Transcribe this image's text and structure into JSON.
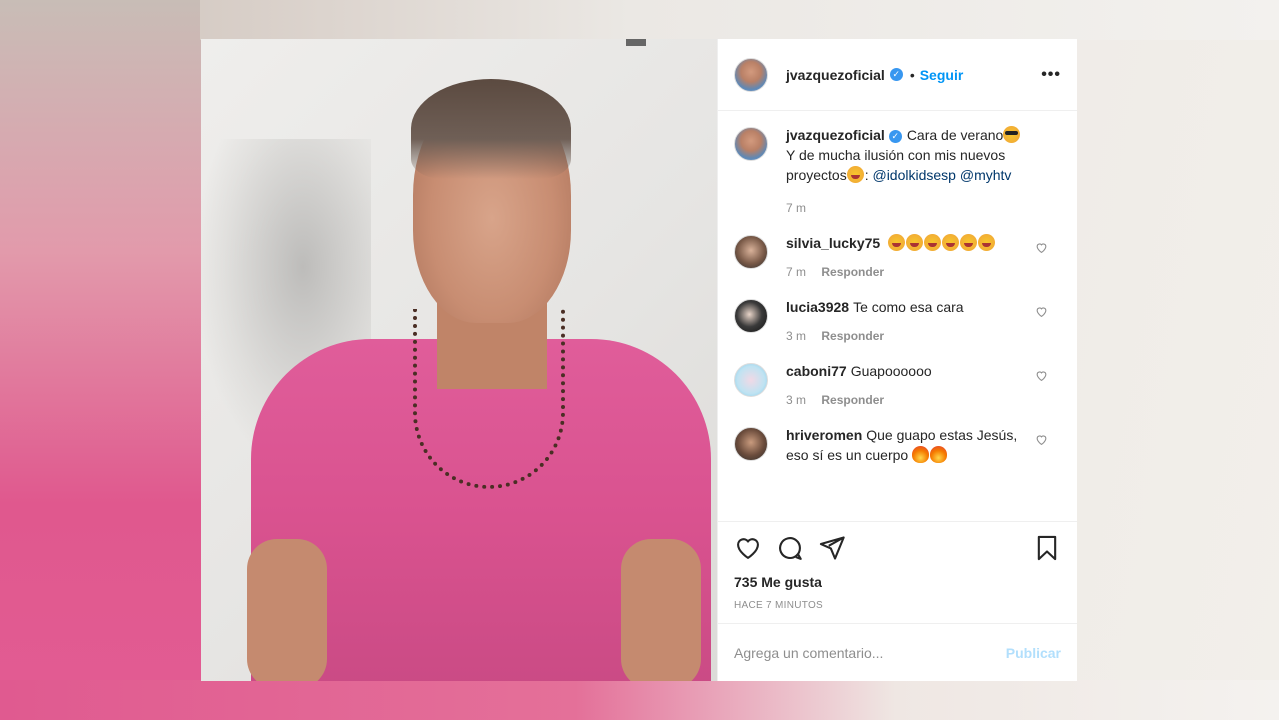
{
  "post": {
    "author": "jvazquezoficial",
    "follow_label": "Seguir",
    "dot": "•",
    "more": "•••",
    "caption": {
      "line1": "Cara de verano",
      "line2": "Y de mucha ilusión con mis nuevos",
      "line3": "proyectos",
      "mentions_sep": ":",
      "mention1": "@idolkidsesp",
      "mention2": "@myhtv",
      "time": "7 m"
    },
    "comments": [
      {
        "user": "silvia_lucky75",
        "text": "",
        "emoji_count": 6,
        "time": "7 m",
        "reply": "Responder"
      },
      {
        "user": "lucia3928",
        "text": "Te como esa cara",
        "time": "3 m",
        "reply": "Responder"
      },
      {
        "user": "caboni77",
        "text": "Guapoooooo",
        "time": "3 m",
        "reply": "Responder"
      },
      {
        "user": "hriveromen",
        "text": "Que guapo estas Jesús, eso sí es un cuerpo",
        "time": "",
        "reply": ""
      }
    ],
    "likes": "735 Me gusta",
    "time_ago": "HACE 7 MINUTOS",
    "comment_placeholder": "Agrega un comentario...",
    "publish_label": "Publicar"
  },
  "colors": {
    "accent": "#0095f6",
    "verified": "#3897f0",
    "publish_disabled": "#b2dffc",
    "shirt": "#e05d9a"
  },
  "icons": [
    "verified-badge-icon",
    "more-options-icon",
    "heart-icon",
    "comment-icon",
    "share-icon",
    "bookmark-icon",
    "small-heart-icon"
  ]
}
